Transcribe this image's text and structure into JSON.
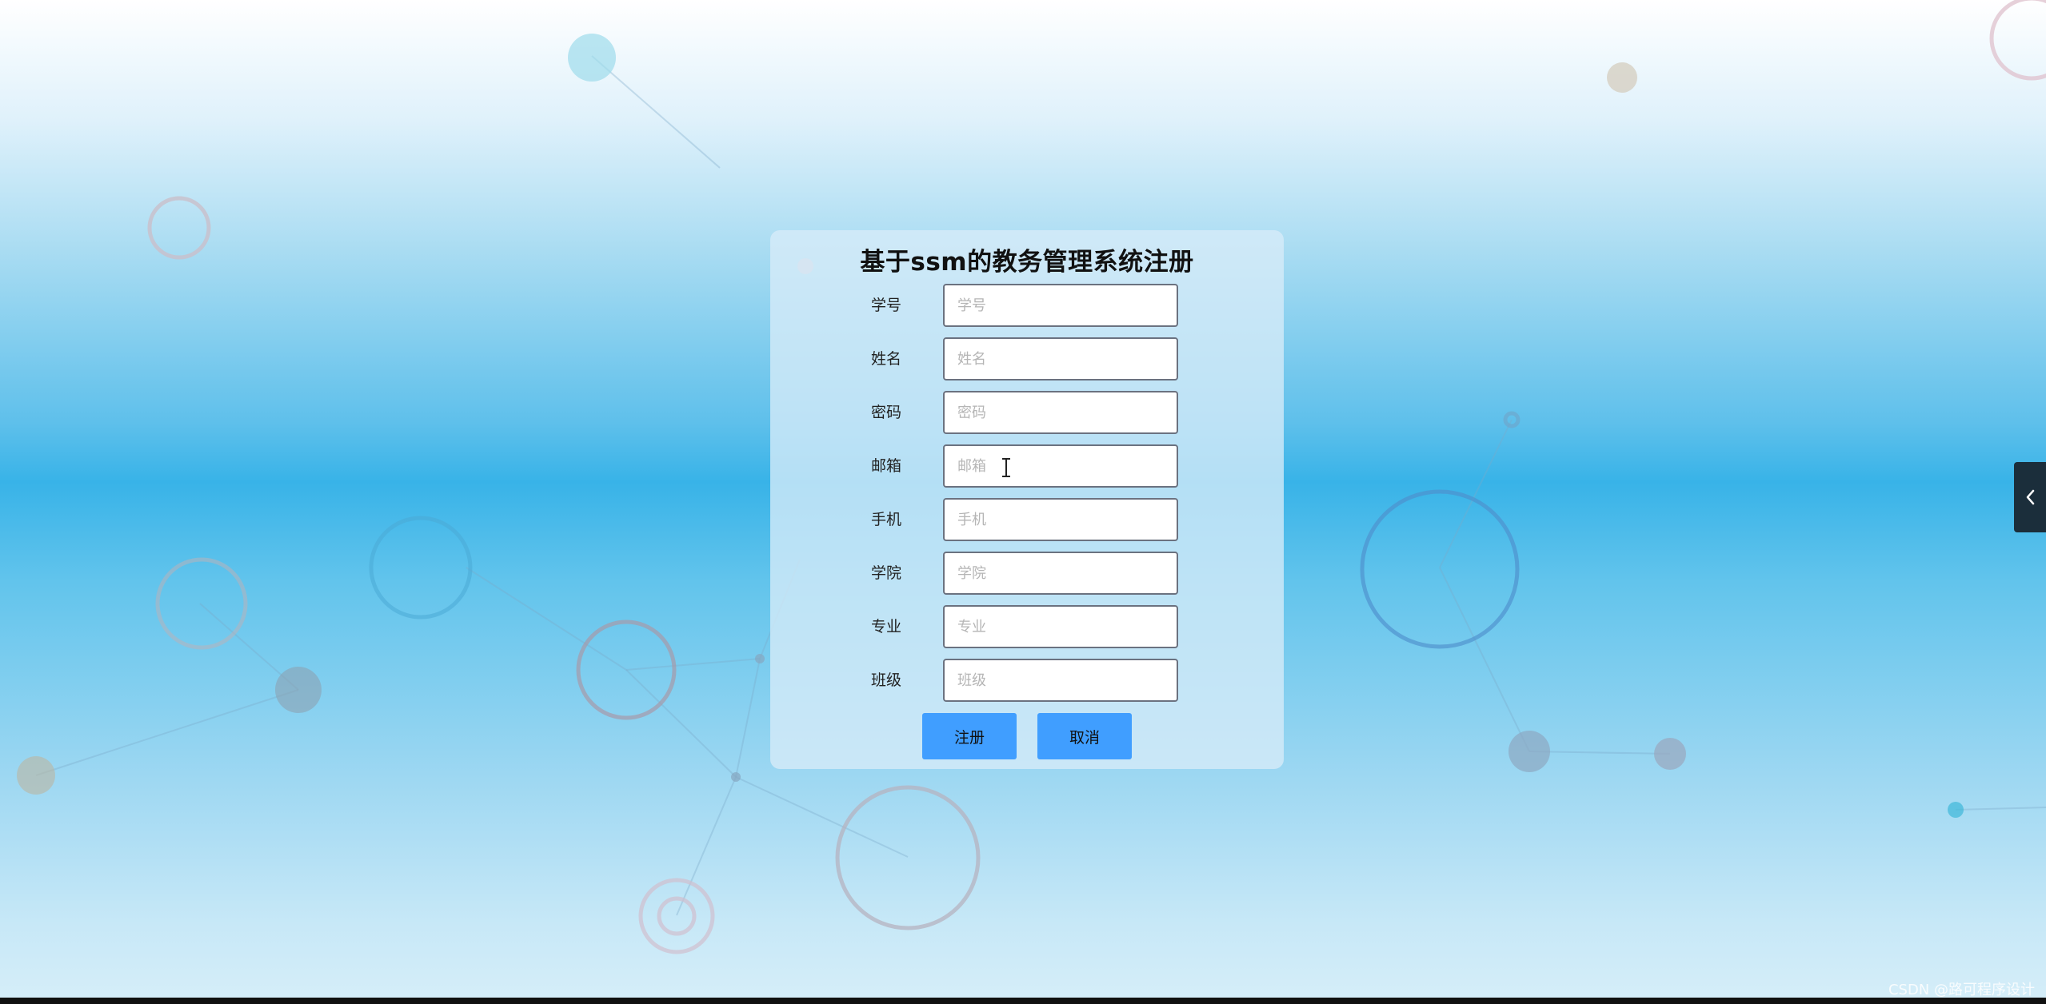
{
  "form": {
    "title": "基于ssm的教务管理系统注册",
    "fields": [
      {
        "label": "学号",
        "placeholder": "学号",
        "value": ""
      },
      {
        "label": "姓名",
        "placeholder": "姓名",
        "value": ""
      },
      {
        "label": "密码",
        "placeholder": "密码",
        "value": ""
      },
      {
        "label": "邮箱",
        "placeholder": "邮箱",
        "value": ""
      },
      {
        "label": "手机",
        "placeholder": "手机",
        "value": ""
      },
      {
        "label": "学院",
        "placeholder": "学院",
        "value": ""
      },
      {
        "label": "专业",
        "placeholder": "专业",
        "value": ""
      },
      {
        "label": "班级",
        "placeholder": "班级",
        "value": ""
      }
    ],
    "buttons": {
      "register_label": "注册",
      "cancel_label": "取消"
    }
  },
  "side_toggle": {
    "icon": "chevron-left-icon"
  },
  "watermark": "CSDN @路可程序设计",
  "colors": {
    "primary_button": "#409eff",
    "side_toggle_bg": "#1b2e3b",
    "background_mid": "#38b3e8"
  }
}
